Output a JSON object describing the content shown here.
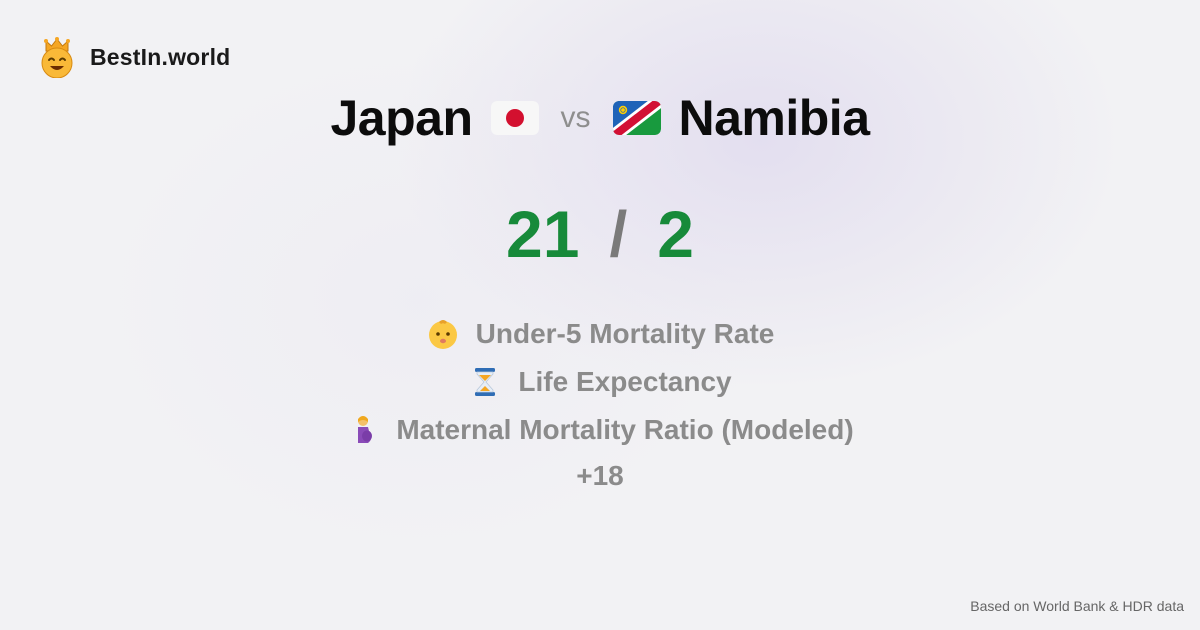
{
  "brand": {
    "name": "BestIn.world",
    "icon": "crowned-smiley-icon"
  },
  "comparison": {
    "left_country": "Japan",
    "left_flag": "japan-flag-icon",
    "vs_label": "vs",
    "right_country": "Namibia",
    "right_flag": "namibia-flag-icon"
  },
  "score": {
    "left": "21",
    "separator": "/",
    "right": "2"
  },
  "metrics": [
    {
      "label": "Under-5 Mortality Rate",
      "icon": "baby-icon"
    },
    {
      "label": "Life Expectancy",
      "icon": "hourglass-icon"
    },
    {
      "label": "Maternal Mortality Ratio (Modeled)",
      "icon": "pregnant-woman-icon"
    }
  ],
  "more_label": "+18",
  "footer": {
    "source": "Based on World Bank & HDR data"
  },
  "colors": {
    "score": "#178a3a",
    "muted_text": "#8b8b8b",
    "brand_text": "#1a1a1a",
    "japan_red": "#d3102f",
    "namibia_blue": "#1f63b8",
    "namibia_green": "#189a3e",
    "namibia_red": "#d21034"
  }
}
